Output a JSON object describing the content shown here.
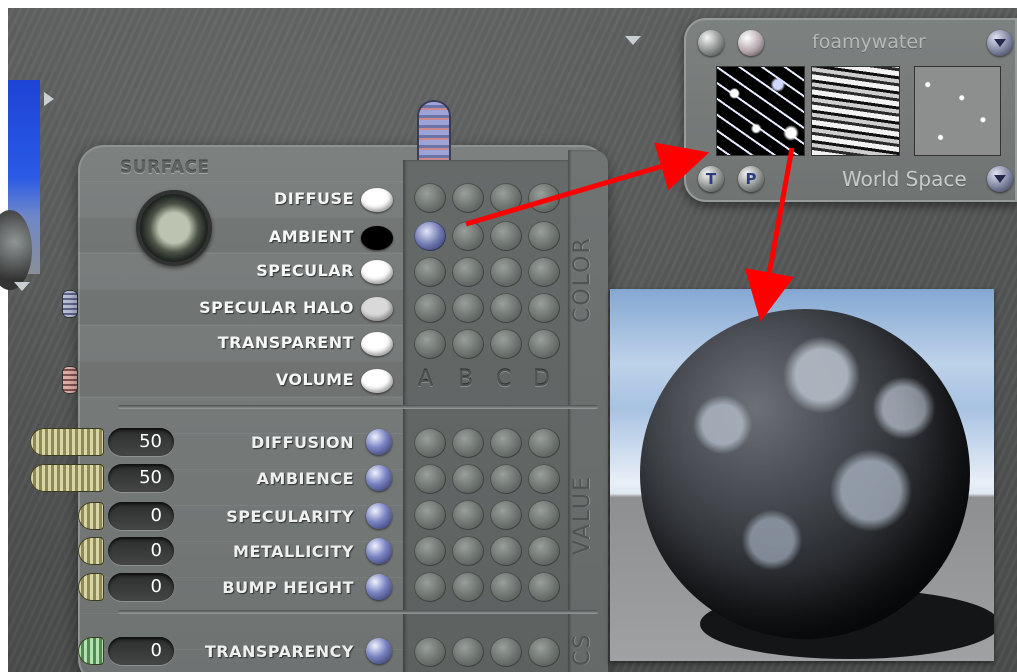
{
  "surface": {
    "title": "SURFACE",
    "channels": [
      {
        "label": "DIFFUSE",
        "swatch_color": "#ffffff"
      },
      {
        "label": "AMBIENT",
        "swatch_color": "#000000"
      },
      {
        "label": "SPECULAR",
        "swatch_color": "#ffffff"
      },
      {
        "label": "SPECULAR HALO",
        "swatch_color": "#d9d9d9"
      },
      {
        "label": "TRANSPARENT",
        "swatch_color": "#ffffff"
      },
      {
        "label": "VOLUME",
        "swatch_color": "#ffffff"
      }
    ],
    "columns": [
      "A",
      "B",
      "C",
      "D"
    ],
    "side_labels": {
      "color": "COLOR",
      "value": "VALUE",
      "bottom": "CS"
    }
  },
  "values": [
    {
      "value": "50",
      "label": "DIFFUSION"
    },
    {
      "value": "50",
      "label": "AMBIENCE"
    },
    {
      "value": "0",
      "label": "SPECULARITY"
    },
    {
      "value": "0",
      "label": "METALLICITY"
    },
    {
      "value": "0",
      "label": "BUMP HEIGHT"
    },
    {
      "value": "0",
      "label": "TRANSPARENCY"
    }
  ],
  "texture": {
    "name": "foamywater",
    "space": "World Space",
    "buttons": {
      "t": "T",
      "p": "P"
    }
  },
  "icons": [
    "collapse-left-arrow-icon",
    "expand-down-arrow-icon",
    "dropdown-arrow-icon",
    "link-arrow-icon"
  ],
  "colors": {
    "arrow": "#ff0000",
    "link_dot": "#6f78b4"
  }
}
